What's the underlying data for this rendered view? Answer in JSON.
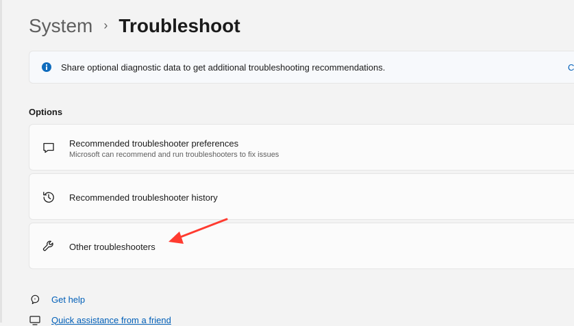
{
  "breadcrumb": {
    "parent": "System",
    "separator": "›",
    "current": "Troubleshoot"
  },
  "info_banner": {
    "icon": "info-icon",
    "text": "Share optional diagnostic data to get additional troubleshooting recommendations.",
    "cut_text": "C"
  },
  "options": {
    "heading": "Options",
    "items": [
      {
        "icon": "chat-bubble-icon",
        "title": "Recommended troubleshooter preferences",
        "subtitle": "Microsoft can recommend and run troubleshooters to fix issues"
      },
      {
        "icon": "history-icon",
        "title": "Recommended troubleshooter history"
      },
      {
        "icon": "wrench-icon",
        "title": "Other troubleshooters"
      }
    ]
  },
  "links": [
    {
      "icon": "help-icon",
      "label": "Get help"
    },
    {
      "icon": "quick-assist-icon",
      "label": "Quick assistance from a friend"
    }
  ],
  "annotation": {
    "arrow_color": "#ff3b30"
  }
}
